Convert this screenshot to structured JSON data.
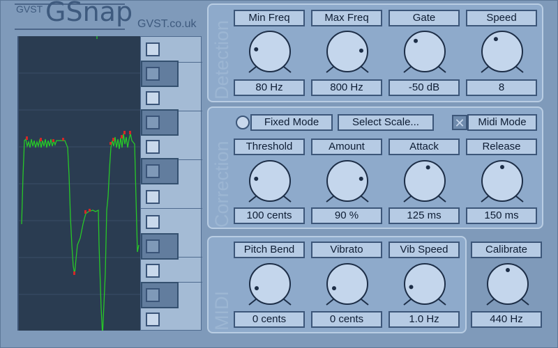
{
  "brand": {
    "prefix": "GVST",
    "name": "GSnap",
    "url": "GVST.co.uk"
  },
  "detection": {
    "title": "Detection",
    "controls": [
      {
        "label": "Min Freq",
        "value": "80 Hz",
        "level": 0.2
      },
      {
        "label": "Max Freq",
        "value": "800 Hz",
        "level": 0.82
      },
      {
        "label": "Gate",
        "value": "-50 dB",
        "level": 0.35
      },
      {
        "label": "Speed",
        "value": "8",
        "level": 0.4
      }
    ]
  },
  "correction": {
    "title": "Correction",
    "fixed_mode_label": "Fixed Mode",
    "select_scale_label": "Select Scale...",
    "midi_mode_label": "Midi Mode",
    "midi_mode_mark": "✕",
    "controls": [
      {
        "label": "Threshold",
        "value": "100 cents",
        "level": 0.2
      },
      {
        "label": "Amount",
        "value": "90 %",
        "level": 0.8
      },
      {
        "label": "Attack",
        "value": "125 ms",
        "level": 0.55
      },
      {
        "label": "Release",
        "value": "150 ms",
        "level": 0.5
      }
    ]
  },
  "midi": {
    "title": "MIDI",
    "controls": [
      {
        "label": "Pitch Bend",
        "value": "0 cents",
        "level": 0.1
      },
      {
        "label": "Vibrato",
        "value": "0 cents",
        "level": 0.1
      },
      {
        "label": "Vib Speed",
        "value": "1.0 Hz",
        "level": 0.12
      }
    ]
  },
  "calibrate": {
    "label": "Calibrate",
    "value": "440 Hz",
    "level": 0.5
  },
  "colors": {
    "background": "#7f9aba",
    "panel": "#8eaacb",
    "scope": "#2a3c51",
    "trace": "#28c828",
    "trace_peak": "#d22828"
  }
}
